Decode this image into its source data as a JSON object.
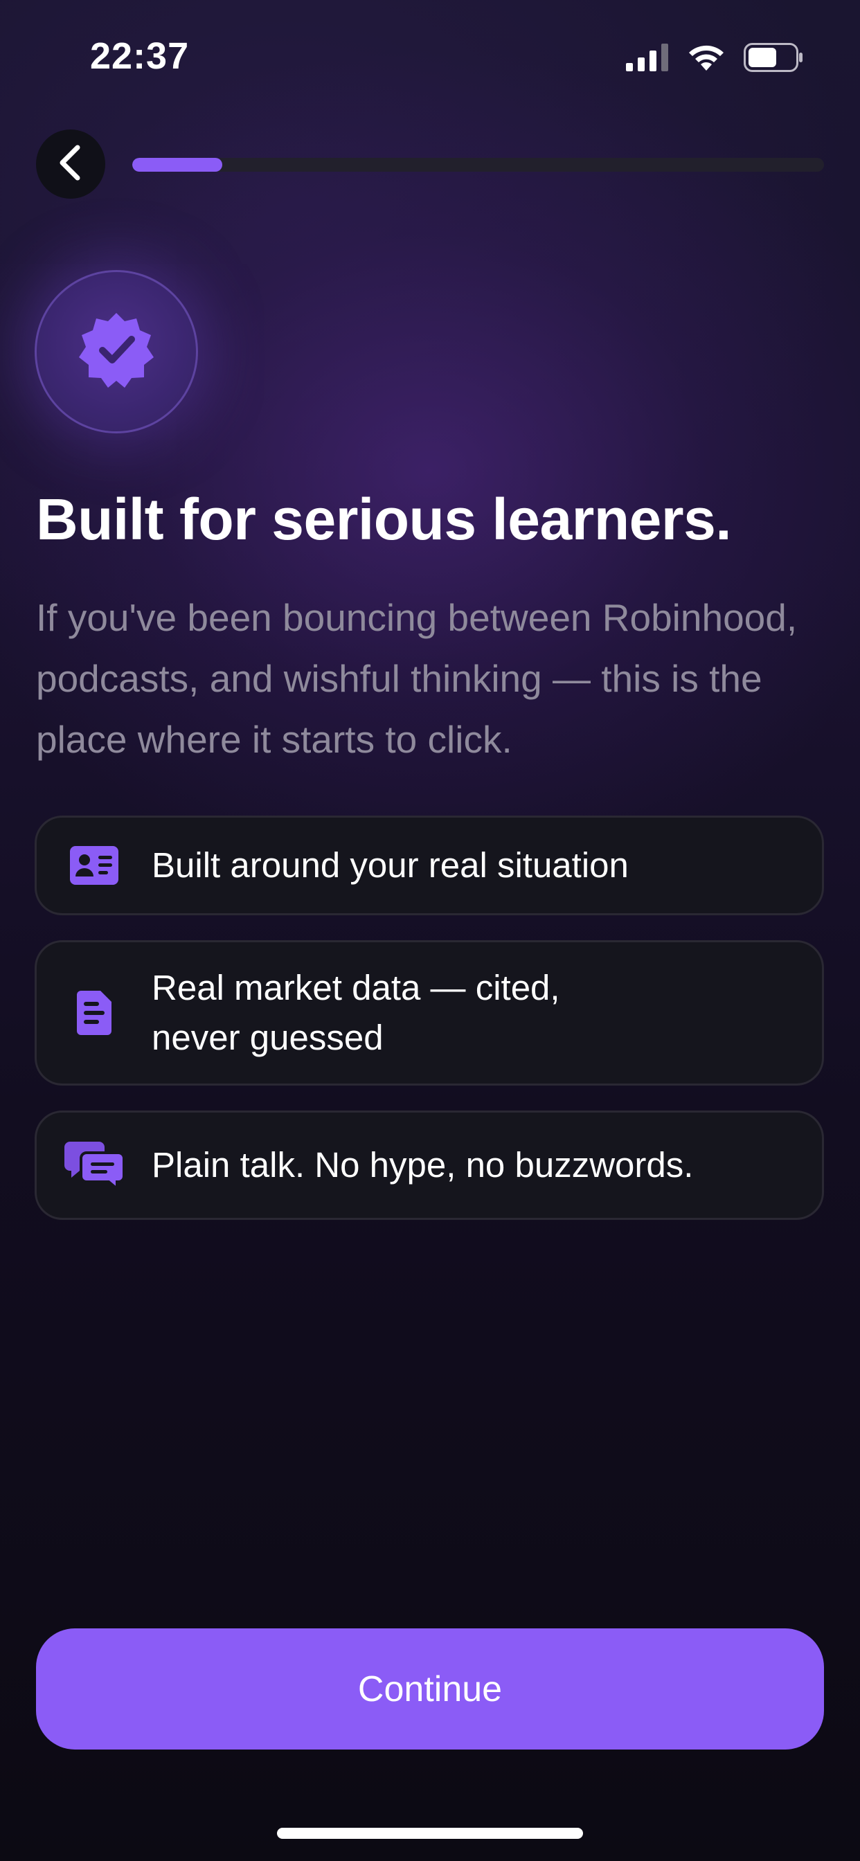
{
  "status_bar": {
    "time": "22:37",
    "icons": [
      "cellular-signal-icon",
      "wifi-icon",
      "battery-icon"
    ]
  },
  "nav": {
    "back_icon": "chevron-left-icon",
    "progress_fraction": 0.13
  },
  "hero": {
    "icon": "verified-badge-icon",
    "headline": "Built for serious learners.",
    "subtext": "If you've been bouncing between Robinhood, podcasts, and wishful thinking — this is the place where it starts to click."
  },
  "features": [
    {
      "icon": "id-card-icon",
      "label": "Built around your real situation"
    },
    {
      "icon": "document-icon",
      "label": "Real market data — cited,\nnever guessed"
    },
    {
      "icon": "chat-bubbles-icon",
      "label": "Plain talk. No hype, no buzzwords."
    }
  ],
  "cta": {
    "label": "Continue"
  },
  "colors": {
    "accent": "#8b5cf6",
    "card_bg": "#15151d",
    "subtext": "#8f8a9c"
  }
}
